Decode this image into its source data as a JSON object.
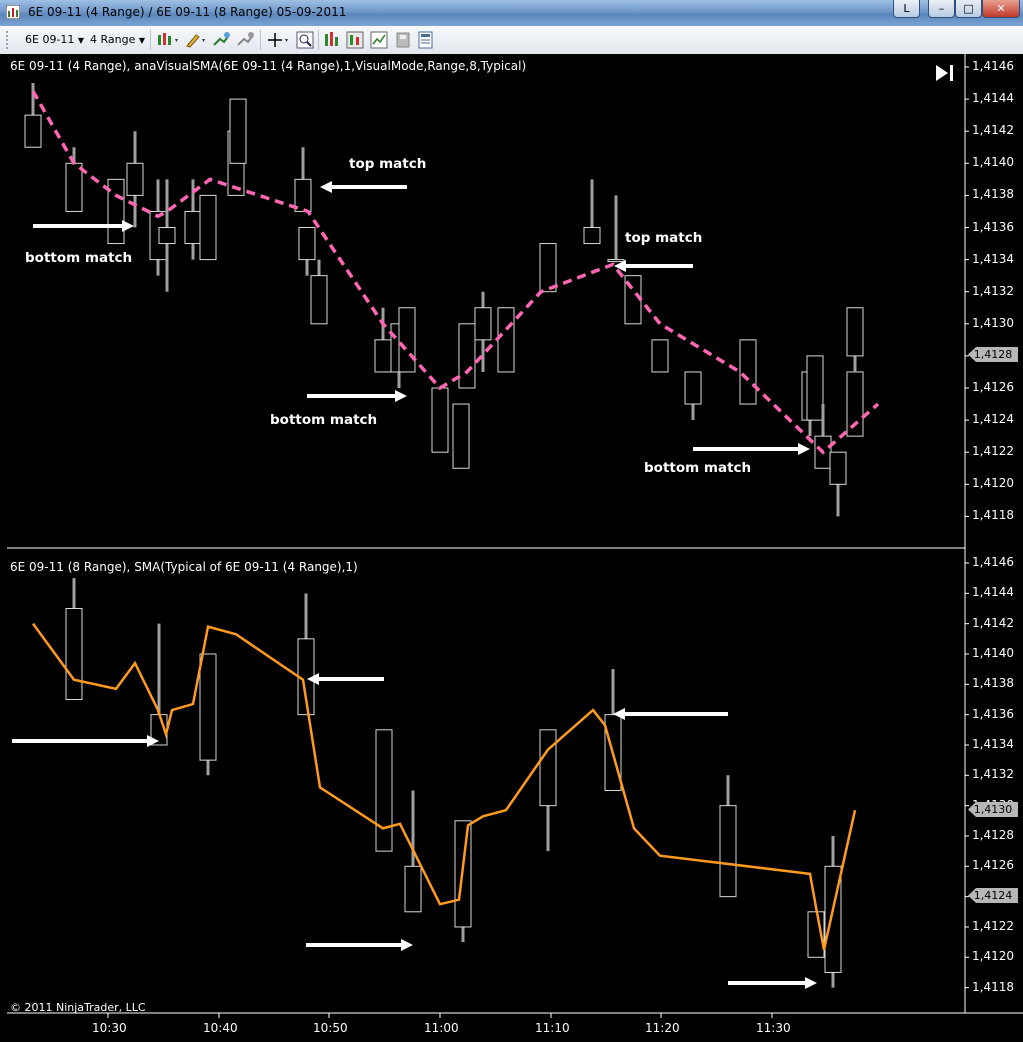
{
  "window": {
    "title": "6E 09-11 (4 Range) / 6E 09-11 (8 Range)  05-09-2011",
    "buttons": {
      "help": "L",
      "minimize": "–",
      "maximize": "□",
      "close": "✕"
    }
  },
  "toolbar": {
    "instrument": "6E 09-11",
    "interval": "4 Range",
    "icons": [
      "chart-style-icon",
      "draw-tool-icon",
      "add-indicator-icon",
      "add-strategy-icon",
      "crosshair-icon",
      "zoom-icon",
      "data-box-icon",
      "chart-trader-icon",
      "template-icon",
      "save-icon",
      "properties-icon"
    ]
  },
  "panels": {
    "top": {
      "label": "6E 09-11 (4 Range),  anaVisualSMA(6E 09-11 (4 Range),1,VisualMode,Range,8,Typical)"
    },
    "bottom": {
      "label": "6E 09-11 (8 Range),  SMA(Typical of 6E 09-11 (4 Range),1)"
    }
  },
  "annotations": {
    "bottom_match_1": "bottom match",
    "top_match_1": "top match",
    "bottom_match_2": "bottom match",
    "top_match_2": "top match",
    "bottom_match_3": "bottom match"
  },
  "axis": {
    "top_ticks": [
      "1,4146",
      "1,4144",
      "1,4142",
      "1,4140",
      "1,4138",
      "1,4136",
      "1,4134",
      "1,4132",
      "1,4130",
      "1,4128",
      "1,4126",
      "1,4124",
      "1,4122",
      "1,4120",
      "1,4118"
    ],
    "bottom_ticks": [
      "1,4146",
      "1,4144",
      "1,4142",
      "1,4140",
      "1,4138",
      "1,4136",
      "1,4134",
      "1,4132",
      "1,4130",
      "1,4128",
      "1,4126",
      "1,4124",
      "1,4122",
      "1,4120",
      "1,4118"
    ],
    "top_last_price": "1,4128",
    "bottom_last_price": "1,4130",
    "bottom_sma_price": "1,4124",
    "time_ticks": [
      "10:30",
      "10:40",
      "10:50",
      "11:00",
      "11:10",
      "11:20",
      "11:30"
    ]
  },
  "copyright": "© 2011 NinjaTrader, LLC",
  "colors": {
    "top_sma": "#ff66b3",
    "bottom_sma": "#ff9a1f",
    "candle_outline": "#d9d9d9",
    "wick": "#a0a0a0",
    "arrow": "#ffffff",
    "background": "#000000"
  },
  "chart_data": [
    {
      "type": "candlestick",
      "panel": "top",
      "series_name": "6E 09-11 (4 Range)",
      "ylim": [
        1.4117,
        1.4147
      ],
      "candles": [
        {
          "t": 1,
          "o": 1.4141,
          "h": 1.4145,
          "l": 1.4141,
          "c": 1.4143
        },
        {
          "t": 2,
          "o": 1.414,
          "h": 1.4141,
          "l": 1.4137,
          "c": 1.4137
        },
        {
          "t": 3,
          "o": 1.4139,
          "h": 1.4139,
          "l": 1.4135,
          "c": 1.4135
        },
        {
          "t": 4,
          "o": 1.4138,
          "h": 1.4142,
          "l": 1.4136,
          "c": 1.414
        },
        {
          "t": 5,
          "o": 1.4137,
          "h": 1.4139,
          "l": 1.4133,
          "c": 1.4134
        },
        {
          "t": 6,
          "o": 1.4136,
          "h": 1.4139,
          "l": 1.4132,
          "c": 1.4135
        },
        {
          "t": 7,
          "o": 1.4135,
          "h": 1.4139,
          "l": 1.4134,
          "c": 1.4137
        },
        {
          "t": 8,
          "o": 1.4134,
          "h": 1.4138,
          "l": 1.4134,
          "c": 1.4138
        },
        {
          "t": 9,
          "o": 1.4138,
          "h": 1.4142,
          "l": 1.4138,
          "c": 1.4142
        },
        {
          "t": 10,
          "o": 1.414,
          "h": 1.4144,
          "l": 1.414,
          "c": 1.4144
        },
        {
          "t": 11,
          "o": 1.4139,
          "h": 1.4141,
          "l": 1.4137,
          "c": 1.4137
        },
        {
          "t": 12,
          "o": 1.4136,
          "h": 1.4136,
          "l": 1.4133,
          "c": 1.4134
        },
        {
          "t": 13,
          "o": 1.4133,
          "h": 1.4134,
          "l": 1.413,
          "c": 1.413
        },
        {
          "t": 14,
          "o": 1.4129,
          "h": 1.4131,
          "l": 1.4127,
          "c": 1.4127
        },
        {
          "t": 15,
          "o": 1.4127,
          "h": 1.413,
          "l": 1.4126,
          "c": 1.413
        },
        {
          "t": 16,
          "o": 1.4131,
          "h": 1.4131,
          "l": 1.4127,
          "c": 1.4127
        },
        {
          "t": 17,
          "o": 1.4126,
          "h": 1.4126,
          "l": 1.4122,
          "c": 1.4122
        },
        {
          "t": 18,
          "o": 1.4121,
          "h": 1.4125,
          "l": 1.4121,
          "c": 1.4125
        },
        {
          "t": 19,
          "o": 1.4126,
          "h": 1.413,
          "l": 1.4126,
          "c": 1.413
        },
        {
          "t": 20,
          "o": 1.4129,
          "h": 1.4132,
          "l": 1.4127,
          "c": 1.4131
        },
        {
          "t": 21,
          "o": 1.4127,
          "h": 1.4131,
          "l": 1.4127,
          "c": 1.4131
        },
        {
          "t": 22,
          "o": 1.4132,
          "h": 1.4135,
          "l": 1.4132,
          "c": 1.4135
        },
        {
          "t": 23,
          "o": 1.4135,
          "h": 1.4139,
          "l": 1.4135,
          "c": 1.4136
        },
        {
          "t": 24,
          "o": 1.4134,
          "h": 1.4138,
          "l": 1.4134,
          "c": 1.4134
        },
        {
          "t": 25,
          "o": 1.4133,
          "h": 1.4133,
          "l": 1.413,
          "c": 1.413
        },
        {
          "t": 26,
          "o": 1.4129,
          "h": 1.4129,
          "l": 1.4127,
          "c": 1.4127
        },
        {
          "t": 27,
          "o": 1.4127,
          "h": 1.4127,
          "l": 1.4124,
          "c": 1.4125
        },
        {
          "t": 28,
          "o": 1.4129,
          "h": 1.4129,
          "l": 1.4125,
          "c": 1.4125
        },
        {
          "t": 29,
          "o": 1.4127,
          "h": 1.4127,
          "l": 1.4123,
          "c": 1.4124
        },
        {
          "t": 30,
          "o": 1.4124,
          "h": 1.4128,
          "l": 1.4124,
          "c": 1.4128
        },
        {
          "t": 31,
          "o": 1.4123,
          "h": 1.4125,
          "l": 1.4121,
          "c": 1.4121
        },
        {
          "t": 32,
          "o": 1.4122,
          "h": 1.4122,
          "l": 1.4118,
          "c": 1.412
        },
        {
          "t": 33,
          "o": 1.4123,
          "h": 1.4127,
          "l": 1.4123,
          "c": 1.4127
        },
        {
          "t": 34,
          "o": 1.4128,
          "h": 1.4131,
          "l": 1.4127,
          "c": 1.4131
        }
      ],
      "sma_line": [
        1.41445,
        1.414,
        1.4138,
        1.41367,
        1.4137,
        1.4139,
        1.4137,
        1.413,
        1.4126,
        1.4127,
        1.4132,
        1.41337,
        1.413,
        1.4127,
        1.4122,
        1.4125
      ]
    },
    {
      "type": "candlestick",
      "panel": "bottom",
      "series_name": "6E 09-11 (8 Range)",
      "ylim": [
        1.4117,
        1.4147
      ],
      "candles": [
        {
          "t": 1,
          "o": 1.4143,
          "h": 1.4145,
          "l": 1.4137,
          "c": 1.4137
        },
        {
          "t": 2,
          "o": 1.4134,
          "h": 1.4142,
          "l": 1.4134,
          "c": 1.4136
        },
        {
          "t": 3,
          "o": 1.4133,
          "h": 1.414,
          "l": 1.4132,
          "c": 1.414
        },
        {
          "t": 4,
          "o": 1.4141,
          "h": 1.4144,
          "l": 1.4136,
          "c": 1.4136
        },
        {
          "t": 5,
          "o": 1.4135,
          "h": 1.4135,
          "l": 1.4127,
          "c": 1.4127
        },
        {
          "t": 6,
          "o": 1.4126,
          "h": 1.4131,
          "l": 1.4123,
          "c": 1.4123
        },
        {
          "t": 7,
          "o": 1.4122,
          "h": 1.4129,
          "l": 1.4121,
          "c": 1.4129
        },
        {
          "t": 8,
          "o": 1.413,
          "h": 1.4135,
          "l": 1.4127,
          "c": 1.4135
        },
        {
          "t": 9,
          "o": 1.4136,
          "h": 1.4139,
          "l": 1.4131,
          "c": 1.4131
        },
        {
          "t": 10,
          "o": 1.413,
          "h": 1.4132,
          "l": 1.4124,
          "c": 1.4124
        },
        {
          "t": 11,
          "o": 1.4123,
          "h": 1.4123,
          "l": 1.412,
          "c": 1.412
        },
        {
          "t": 12,
          "o": 1.4119,
          "h": 1.4128,
          "l": 1.4118,
          "c": 1.4126
        }
      ],
      "sma_line": [
        1.4142,
        1.4138,
        1.4138,
        1.4139,
        1.4135,
        1.4137,
        1.4142,
        1.4141,
        1.4138,
        1.4131,
        1.4128,
        1.4128,
        1.4123,
        1.4124,
        1.4129,
        1.413,
        1.4134,
        1.4136,
        1.4135,
        1.4128,
        1.4127,
        1.4126,
        1.41255,
        1.412,
        1.413
      ]
    }
  ]
}
